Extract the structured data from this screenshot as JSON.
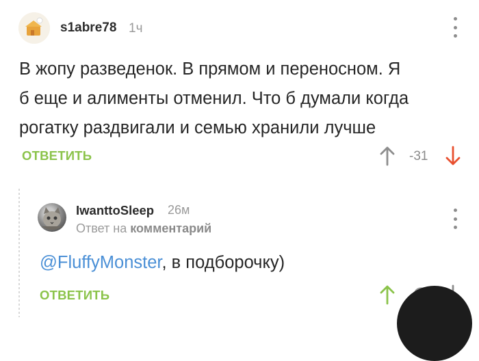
{
  "colors": {
    "accent_green": "#8bc34a",
    "downvote_red": "#e8502f",
    "mention_blue": "#4a8fd6",
    "text": "#262626",
    "muted": "#9a9a9a"
  },
  "comment": {
    "username": "s1abre78",
    "time": "1ч",
    "lines": [
      "В жопу разведенок. В прямом и переносном. Я",
      "б еще и алименты отменил. Что б думали когда",
      "рогатку раздвигали и семью хранили лучше"
    ],
    "reply_label": "ОТВЕТИТЬ",
    "rating": "-31",
    "icons": {
      "upvote": "arrow-up-icon",
      "downvote": "arrow-down-icon",
      "menu": "more-vertical-icon"
    }
  },
  "reply": {
    "username": "IwanttoSleep",
    "time": "26м",
    "reply_to_prefix": "Ответ на",
    "reply_to_link": "комментарий",
    "mention": "@FluffyMonster",
    "text_rest": ", в подборочку)",
    "reply_label": "ОТВЕТИТЬ",
    "icons": {
      "upvote": "arrow-up-icon",
      "clock": "clock-icon",
      "downvote": "arrow-down-icon",
      "menu": "more-vertical-icon"
    }
  }
}
